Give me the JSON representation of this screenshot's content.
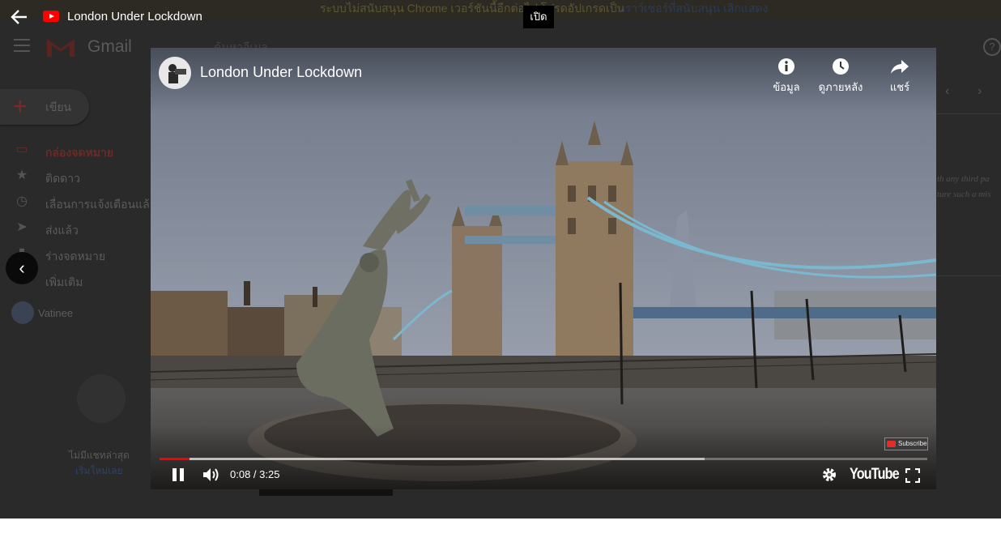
{
  "overlay": {
    "title": "London Under Lockdown",
    "open_button": "เปิด"
  },
  "gmail_background": {
    "banner_text": "ระบบไม่สนับสนุน Chrome เวอร์ชันนี้อีกต่อไป โปรดอัปเกรดเป็น",
    "banner_link_browser": "เบราว์เซอร์ที่สนับสนุน",
    "banner_link_dismiss": "เลิกแสดง",
    "logo_text": "Gmail",
    "search_placeholder": "ค้นหาอีเมล",
    "compose_label": "เขียน",
    "nav_items": [
      {
        "label": "กล่องจดหมาย",
        "icon": "inbox-icon"
      },
      {
        "label": "ติดดาว",
        "icon": "star-icon"
      },
      {
        "label": "เลื่อนการแจ้งเตือนแล้ว",
        "icon": "clock-icon"
      },
      {
        "label": "ส่งแล้ว",
        "icon": "send-icon"
      },
      {
        "label": "ร่างจดหมาย",
        "icon": "draft-icon"
      },
      {
        "label": "เพิ่มเติม",
        "icon": "chevron-down-icon"
      }
    ],
    "user_name": "Vatinee",
    "no_recent_chats": "ไม่มีแชทล่าสุด",
    "start_new_chat": "เริ่มใหม่เลย",
    "partial_text_1": "th any third pa",
    "partial_text_2": "ture such a mis"
  },
  "player": {
    "title": "London Under Lockdown",
    "actions": {
      "info": "ข้อมูล",
      "watch_later": "ดูภายหลัง",
      "share": "แชร์"
    },
    "subscribe_label": "Subscribe",
    "time_display": "0:08 / 3:25",
    "elapsed_seconds": 8,
    "duration_seconds": 205,
    "buffered_fraction": 0.71,
    "youtube_label": "YouTube"
  },
  "colors": {
    "progress_played": "#ff0000",
    "youtube_red": "#ff0000"
  }
}
